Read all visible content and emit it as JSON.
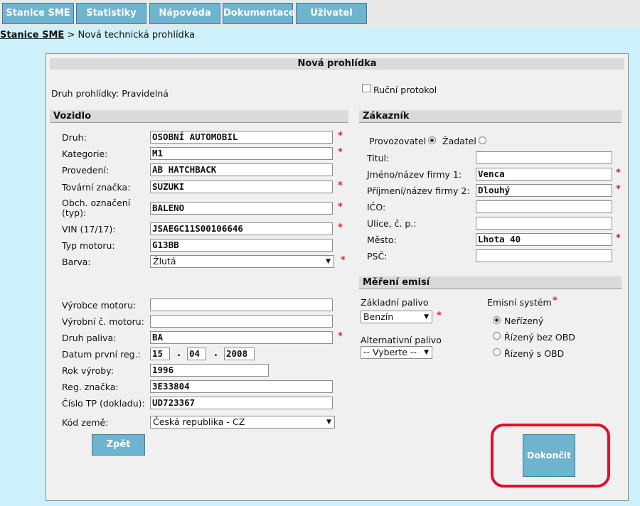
{
  "nav": [
    "Stanice SME",
    "Statistiky",
    "Nápověda",
    "Dokumentace",
    "Uživatel"
  ],
  "breadcrumb": {
    "home": "Stanice SME",
    "separator": ">",
    "current": "Nová technická prohlídka"
  },
  "title": "Nová prohlídka",
  "inspection_type": "Druh prohlídky: Pravidelná",
  "manual_protocol": "Ruční protokol",
  "vehicle": {
    "heading": "Vozidlo",
    "druh": {
      "label": "Druh:",
      "value": "OSOBNÍ AUTOMOBIL"
    },
    "kategorie": {
      "label": "Kategorie:",
      "value": "M1"
    },
    "provedeni": {
      "label": "Provedení:",
      "value": "AB HATCHBACK"
    },
    "znacka": {
      "label": "Tovární značka:",
      "value": "SUZUKI"
    },
    "obch_line1": "Obch. označení",
    "obch_line2": "(typ):",
    "obch_value": "BALENO",
    "vin": {
      "label": "VIN (17/17):",
      "value": "JSAEGC11S00106646"
    },
    "motor": {
      "label": "Typ motoru:",
      "value": "G13BB"
    },
    "barva": {
      "label": "Barva:",
      "value": "Žlutá"
    },
    "vyrobce_motoru": {
      "label": "Výrobce motoru:",
      "value": ""
    },
    "vyrobni_cislo": {
      "label": "Výrobní č. motoru:",
      "value": ""
    },
    "palivo": {
      "label": "Druh paliva:",
      "value": "BA"
    },
    "datum": {
      "label": "Datum první reg.:",
      "day": "15",
      "month": "04",
      "year": "2008",
      "sep": "."
    },
    "rok": {
      "label": "Rok výroby:",
      "value": "1996"
    },
    "spz": {
      "label": "Reg. značka:",
      "value": "3E33804"
    },
    "tp": {
      "label": "Číslo TP (dokladu):",
      "value": "UD723367"
    },
    "zeme": {
      "label": "Kód země:",
      "value": "Česká republika - CZ"
    }
  },
  "customer": {
    "heading": "Zákazník",
    "provozovatel": "Provozovatel",
    "zadatel": "Žadatel",
    "titul": {
      "label": "Titul:",
      "value": ""
    },
    "jmeno": {
      "label": "Jméno/název firmy 1:",
      "value": "Venca"
    },
    "prijmeni": {
      "label": "Příjmení/název firmy 2:",
      "value": "Dlouhý"
    },
    "ico": {
      "label": "IČO:",
      "value": ""
    },
    "ulice": {
      "label": "Ulice, č. p.:",
      "value": ""
    },
    "mesto": {
      "label": "Město:",
      "value": "Lhota 40"
    },
    "psc": {
      "label": "PSČ:",
      "value": ""
    }
  },
  "emissions": {
    "heading": "Měření emisí",
    "fuel_label": "Základní palivo",
    "fuel_value": "Benzín",
    "alt_label": "Alternativní palivo",
    "alt_value": "-- Vyberte --",
    "system_label": "Emisní systém",
    "opt1": "Neřízený",
    "opt2": "Řízený bez OBD",
    "opt3": "Řízený s OBD"
  },
  "buttons": {
    "back": "Zpět",
    "finish": "Dokončit"
  },
  "required_mark": "*",
  "colors": {
    "accent": "#6fb4cf",
    "background": "#cdf0fb",
    "required": "#e02020",
    "highlight": "#e0102a"
  }
}
